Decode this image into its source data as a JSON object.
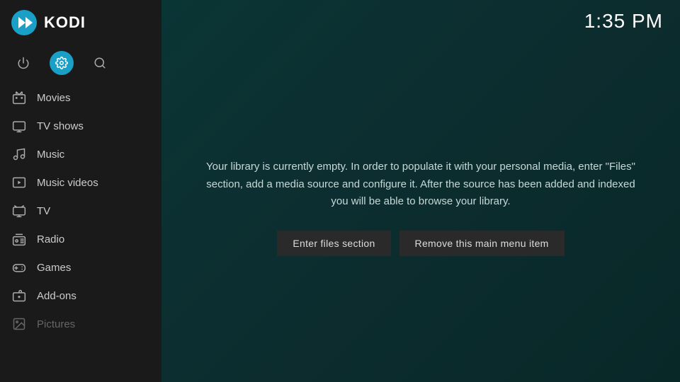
{
  "app": {
    "name": "KODI"
  },
  "clock": {
    "time": "1:35 PM"
  },
  "sidebar": {
    "icons": [
      {
        "id": "power",
        "label": "Power",
        "symbol": "⏻",
        "active": false
      },
      {
        "id": "settings",
        "label": "Settings",
        "symbol": "⚙",
        "active": true
      },
      {
        "id": "search",
        "label": "Search",
        "symbol": "⌕",
        "active": false
      }
    ],
    "nav_items": [
      {
        "id": "movies",
        "label": "Movies",
        "icon": "🎬"
      },
      {
        "id": "tv-shows",
        "label": "TV shows",
        "icon": "🖥"
      },
      {
        "id": "music",
        "label": "Music",
        "icon": "🎧"
      },
      {
        "id": "music-videos",
        "label": "Music videos",
        "icon": "🎞"
      },
      {
        "id": "tv",
        "label": "TV",
        "icon": "📺"
      },
      {
        "id": "radio",
        "label": "Radio",
        "icon": "📻"
      },
      {
        "id": "games",
        "label": "Games",
        "icon": "🎮"
      },
      {
        "id": "add-ons",
        "label": "Add-ons",
        "icon": "📦"
      },
      {
        "id": "pictures",
        "label": "Pictures",
        "icon": "🖼"
      }
    ]
  },
  "main": {
    "library_message": "Your library is currently empty. In order to populate it with your personal media, enter \"Files\" section, add a media source and configure it. After the source has been added and indexed you will be able to browse your library.",
    "buttons": [
      {
        "id": "enter-files",
        "label": "Enter files section"
      },
      {
        "id": "remove-menu-item",
        "label": "Remove this main menu item"
      }
    ]
  }
}
